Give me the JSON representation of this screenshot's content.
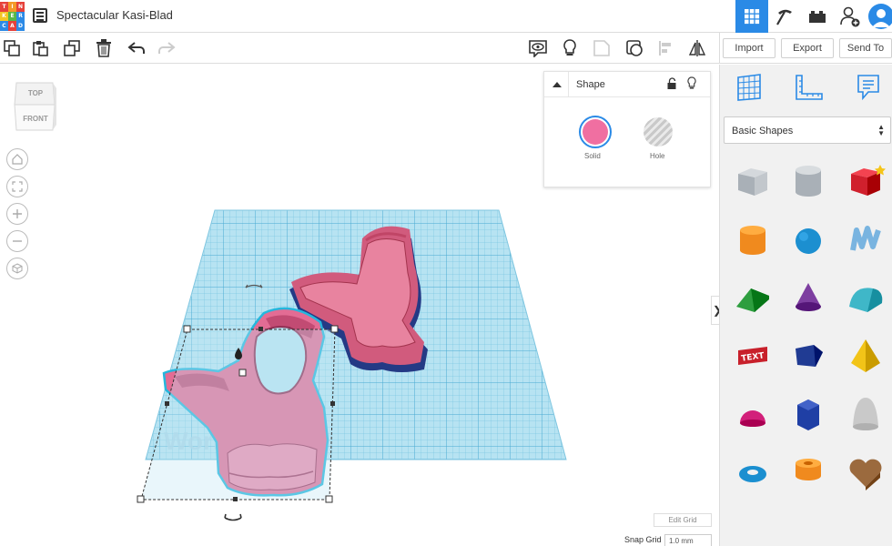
{
  "app": {
    "logo_letters": [
      "T",
      "I",
      "N",
      "K",
      "E",
      "R",
      "C",
      "A",
      "D"
    ],
    "logo_colors": [
      "#e6413b",
      "#f49a28",
      "#e6413b",
      "#f3c623",
      "#58b847",
      "#2b8ae6",
      "#2b8ae6",
      "#e6413b",
      "#2b8ae6"
    ],
    "title": "Spectacular Kasi-Blad"
  },
  "topbar": {
    "icons": [
      "grid-view-icon",
      "pickaxe-icon",
      "bricks-icon",
      "add-user-icon",
      "user-avatar-icon"
    ],
    "accent": "#2a8ae6"
  },
  "toolbar": {
    "buttons": [
      "copy",
      "paste",
      "duplicate",
      "delete",
      "undo",
      "redo"
    ],
    "view_buttons": [
      "show-notes",
      "light-bulb",
      "group",
      "ungroup",
      "align",
      "mirror"
    ],
    "import_label": "Import",
    "export_label": "Export",
    "send_to_label": "Send To"
  },
  "viewcube": {
    "top_label": "TOP",
    "front_label": "FRONT"
  },
  "shape_panel": {
    "title": "Shape",
    "solid_label": "Solid",
    "hole_label": "Hole",
    "solid_color": "#f06fa1"
  },
  "right_panel": {
    "tool_icons": [
      "workplane-icon",
      "ruler-icon",
      "notes-icon"
    ],
    "category": "Basic Shapes",
    "shapes": [
      {
        "name": "box-striped",
        "color": "#a9b0b7"
      },
      {
        "name": "cylinder-striped",
        "color": "#a9b0b7"
      },
      {
        "name": "box",
        "color": "#d0202d"
      },
      {
        "name": "cylinder",
        "color": "#f08a1e"
      },
      {
        "name": "sphere",
        "color": "#1c8fd0"
      },
      {
        "name": "scribble",
        "color": "#79b4e0"
      },
      {
        "name": "roof",
        "color": "#2e9e3f"
      },
      {
        "name": "cone",
        "color": "#7d3ea0"
      },
      {
        "name": "round-roof",
        "color": "#3fb7c8"
      },
      {
        "name": "text",
        "color": "#c8202b"
      },
      {
        "name": "polygon",
        "color": "#203b93"
      },
      {
        "name": "pyramid",
        "color": "#f2c418"
      },
      {
        "name": "half-sphere",
        "color": "#d2207a"
      },
      {
        "name": "hexagonal-prism",
        "color": "#1f3fa5"
      },
      {
        "name": "paraboloid",
        "color": "#c9c9c9"
      },
      {
        "name": "torus",
        "color": "#1b8fd0"
      },
      {
        "name": "tube",
        "color": "#f08a1e"
      },
      {
        "name": "heart",
        "color": "#9b6a3e"
      }
    ]
  },
  "workplane": {
    "watermark": "Workplane",
    "edit_grid_label": "Edit Grid",
    "snap_grid_label": "Snap Grid",
    "snap_grid_value": "1.0 mm"
  }
}
